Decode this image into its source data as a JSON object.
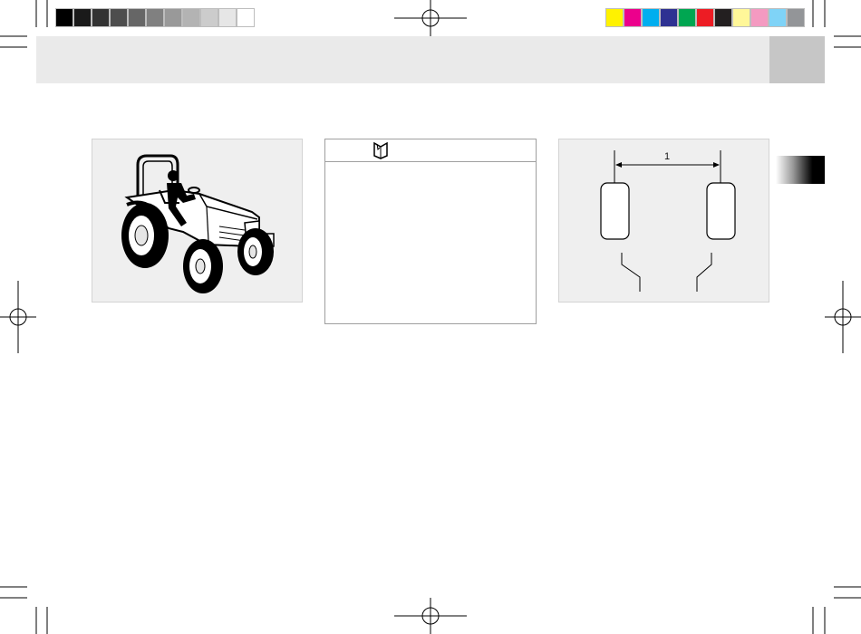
{
  "print_marks": {
    "gray_scale": [
      "#000000",
      "#1a1a1a",
      "#333333",
      "#4d4d4d",
      "#666666",
      "#808080",
      "#999999",
      "#b3b3b3",
      "#cccccc",
      "#e6e6e6",
      "#ffffff"
    ],
    "color_bar": [
      "#fff200",
      "#ec008c",
      "#00aeef",
      "#2e3192",
      "#00a651",
      "#ed1c24",
      "#231f20",
      "#fff799",
      "#f49ac1",
      "#7fd3f7",
      "#939598"
    ]
  },
  "colors": {
    "header_band": "#eaeaea",
    "header_tab": "#c6c6c6",
    "figure_background": "#efefef"
  },
  "figures": {
    "tractor": {
      "icon": "tractor-illustration-icon"
    },
    "note": {
      "icon": "book-icon"
    },
    "track_width": {
      "dimension_label": "1"
    }
  }
}
